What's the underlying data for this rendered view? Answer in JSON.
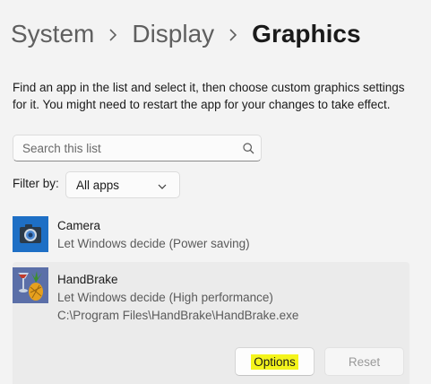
{
  "breadcrumb": {
    "items": [
      "System",
      "Display"
    ],
    "current": "Graphics"
  },
  "description": "Find an app in the list and select it, then choose custom graphics settings for it. You might need to restart the app for your changes to take effect.",
  "search": {
    "placeholder": "Search this list",
    "value": ""
  },
  "filter": {
    "label": "Filter by:",
    "selected": "All apps"
  },
  "apps": [
    {
      "name": "Camera",
      "preference": "Let Windows decide (Power saving)",
      "icon": "camera-icon"
    },
    {
      "name": "HandBrake",
      "preference": "Let Windows decide (High performance)",
      "path": "C:\\Program Files\\HandBrake\\HandBrake.exe",
      "icon": "handbrake-icon",
      "selected": true,
      "options_label": "Options",
      "reset_label": "Reset"
    }
  ],
  "colors": {
    "background": "#f3f3f3",
    "selected_row": "#ebebeb",
    "camera_tile": "#1e6fc5",
    "highlight": "#f4f41c"
  }
}
